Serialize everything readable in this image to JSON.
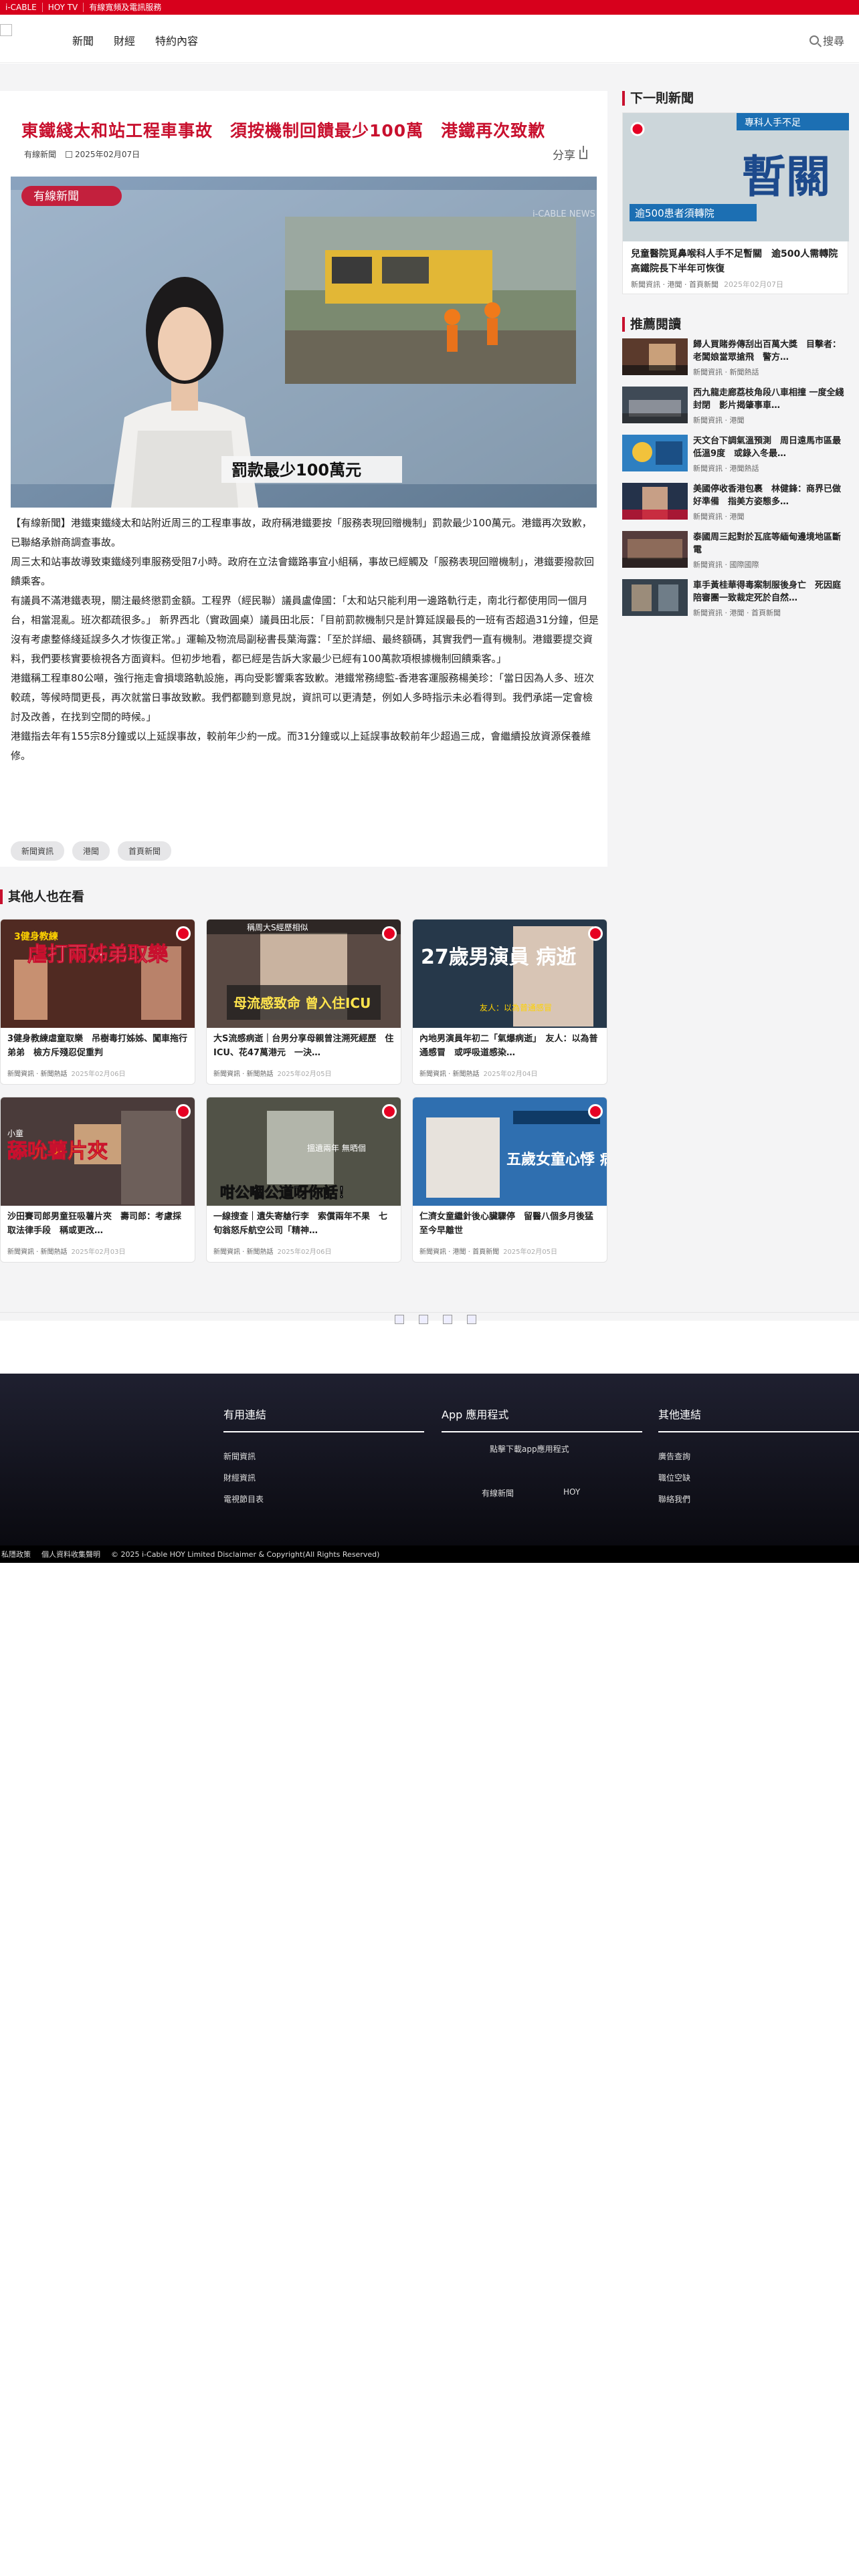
{
  "topbar": {
    "links": [
      "i-CABLE",
      "HOY TV",
      "有線寬頻及電訊服務"
    ]
  },
  "header": {
    "nav": [
      "新聞",
      "財經",
      "特約內容"
    ],
    "search_label": "搜尋"
  },
  "article": {
    "title": "東鐵綫太和站工程車事故　須按機制回饋最少100萬　港鐵再次致歉",
    "source": "有線新聞",
    "date": "2025年02月07日",
    "share_label": "分享",
    "hero": {
      "logo_text": "有線新聞",
      "caption": "罰款最少100萬元",
      "watermark": "i-CABLE NEWS",
      "colors": {
        "accent": "#c8102e",
        "caption_bg": "#f5f5f5"
      }
    },
    "paragraphs": [
      "【有線新聞】港鐵東鐵綫太和站附近周三的工程車事故，政府稱港鐵要按「服務表現回贈機制」罰款最少100萬元。港鐵再次致歉，已聯絡承辦商調查事故。",
      "周三太和站事故導致東鐵綫列車服務受阻7小時。政府在立法會鐵路事宜小組稱，事故已經觸及「服務表現回贈機制」，港鐵要撥款回饋乘客。",
      "有議員不滿港鐵表現，關注最終懲罰金額。工程界（經民聯）議員盧偉國：「太和站只能利用一邊路軌行走，南北行都使用同一個月台，相當混亂。班次都疏很多。」 新界西北（實政圓桌）議員田北辰：「目前罰款機制只是計算延誤最長的一班有否超過31分鐘，但是沒有考慮整條綫延誤多久才恢復正常。」運輸及物流局副秘書長葉海露：「至於詳細、最終額碼，其實我們一直有機制。港鐵要提交資料，我們要核實要檢視各方面資料。但初步地看，都已經是告訴大家最少已經有100萬款項根據機制回饋乘客。」",
      "港鐵稱工程車80公噸，強行拖走會損壞路軌設施，再向受影響乘客致歉。港鐵常務總監-香港客運服務楊美珍：「當日因為人多、班次較疏，等候時間更長，再次就當日事故致歉。我們都聽到意見說，資訊可以更清楚，例如人多時指示未必看得到。我們承諾一定會檢討及改善，在找到空間的時候。」",
      "港鐵指去年有155宗8分鐘或以上延誤事故，較前年少約一成。而31分鐘或以上延誤事故較前年少超過三成，會繼續投放資源保養維修。"
    ],
    "tags": [
      "新聞資訊",
      "港聞",
      "首頁新聞"
    ]
  },
  "sidebar": {
    "next_heading": "下一則新聞",
    "next": {
      "title": "兒童醫院覓鼻喉科人手不足暫關　逾500人需轉院　高鐵院長下半年可恢復",
      "meta": "新聞資訊 · 港聞 · 首頁新聞",
      "date": "2025年02月07日",
      "img_big": "暫關",
      "img_sub": "逾500患者須轉院",
      "img_top": "專科人手不足"
    },
    "rec_heading": "推薦閱讀",
    "rec": [
      {
        "title": "歸人買賭券傳刮出百萬大獎　目擊者：老闆娘當眾搶飛　警方…",
        "meta": "新聞資訊 · 新聞熱話"
      },
      {
        "title": "西九龍走廊荔枝角段八車相撞 一度全綫封閉　影片揭肇事車…",
        "meta": "新聞資訊 · 港聞"
      },
      {
        "title": "天文台下調氣溫預測　周日遠馬市區最低溫9度　或錄入冬最…",
        "meta": "新聞資訊 · 港聞熱話"
      },
      {
        "title": "美國停收香港包裹　林健鋒：商界已做好準備　指美方姿態多…",
        "meta": "新聞資訊 · 港聞"
      },
      {
        "title": "泰國周三起對於瓦底等緬甸邊境地區斷電",
        "meta": "新聞資訊 · 國際國際"
      },
      {
        "title": "車手黃桂華得毒案制服後身亡　死因庭陪審團一致裁定死於自然…",
        "meta": "新聞資訊 · 港聞 · 首頁新聞"
      }
    ]
  },
  "others": {
    "heading": "其他人也在看",
    "cards": [
      {
        "title": "3健身教練虐童取樂　吊樹毒打姊姊、闖車拖行弟弟　檢方斥殘忍促重判",
        "meta": "新聞資訊 · 新聞熱話",
        "date": "2025年02月06日",
        "img_text": "虐打兩姊弟取樂",
        "img_sub": "3健身教練"
      },
      {
        "title": "大S流感病逝｜台男分享母親曾注溯死經歷　住ICU、花47萬港元　一決…",
        "meta": "新聞資訊 · 新聞熱話",
        "date": "2025年02月05日",
        "img_text": "母流感致命 曾入住ICU",
        "img_sub": "稱周大S經歷相似"
      },
      {
        "title": "內地男演員年初二「氣爆病逝」　友人：以為普通感冒　或呼吸道感染…",
        "meta": "新聞資訊 · 新聞熱話",
        "date": "2025年02月04日",
        "img_text": "27歲男演員 病逝",
        "img_sub": "友人：以為普通感冒"
      },
      {
        "title": "沙田賽司郎男童狂吸薯片夾　壽司郎：考慮採取法律手段　稱或更改…",
        "meta": "新聞資訊 · 新聞熱話",
        "date": "2025年02月03日",
        "img_text": "舔吮薯片夾",
        "img_sub": "小童"
      },
      {
        "title": "一線搜查｜遺失寄艙行李　索償兩年不果　七旬翁怒斥航空公司「精神…",
        "meta": "新聞資訊 · 新聞熱話",
        "date": "2025年02月06日",
        "img_text": "咁公嗰公道呀你話！",
        "img_sub": "搵遺兩年 無晒個"
      },
      {
        "title": "仁濟女童繼針後心臟驟停　留醫八個多月後猛至今早離世",
        "meta": "新聞資訊 · 港聞 · 首頁新聞",
        "date": "2025年02月05日",
        "img_text": "五歲女童心悸 病情惡化離世",
        "img_sub": ""
      }
    ]
  },
  "footer": {
    "useful_heading": "有用連結",
    "useful_links": [
      "新聞資訊",
      "財經資訊",
      "電視節目表"
    ],
    "app_heading": "App 應用程式",
    "app_text": "點擊下載app應用程式",
    "app_names": [
      "有線新聞",
      "HOY"
    ],
    "other_heading": "其他連結",
    "other_links": [
      "廣告查詢",
      "職位空缺",
      "聯絡我們"
    ],
    "bottom": [
      "私隱政策",
      "個人資料收集聲明",
      "© 2025 i-Cable HOY Limited Disclaimer & Copyright(All Rights Reserved)"
    ]
  }
}
